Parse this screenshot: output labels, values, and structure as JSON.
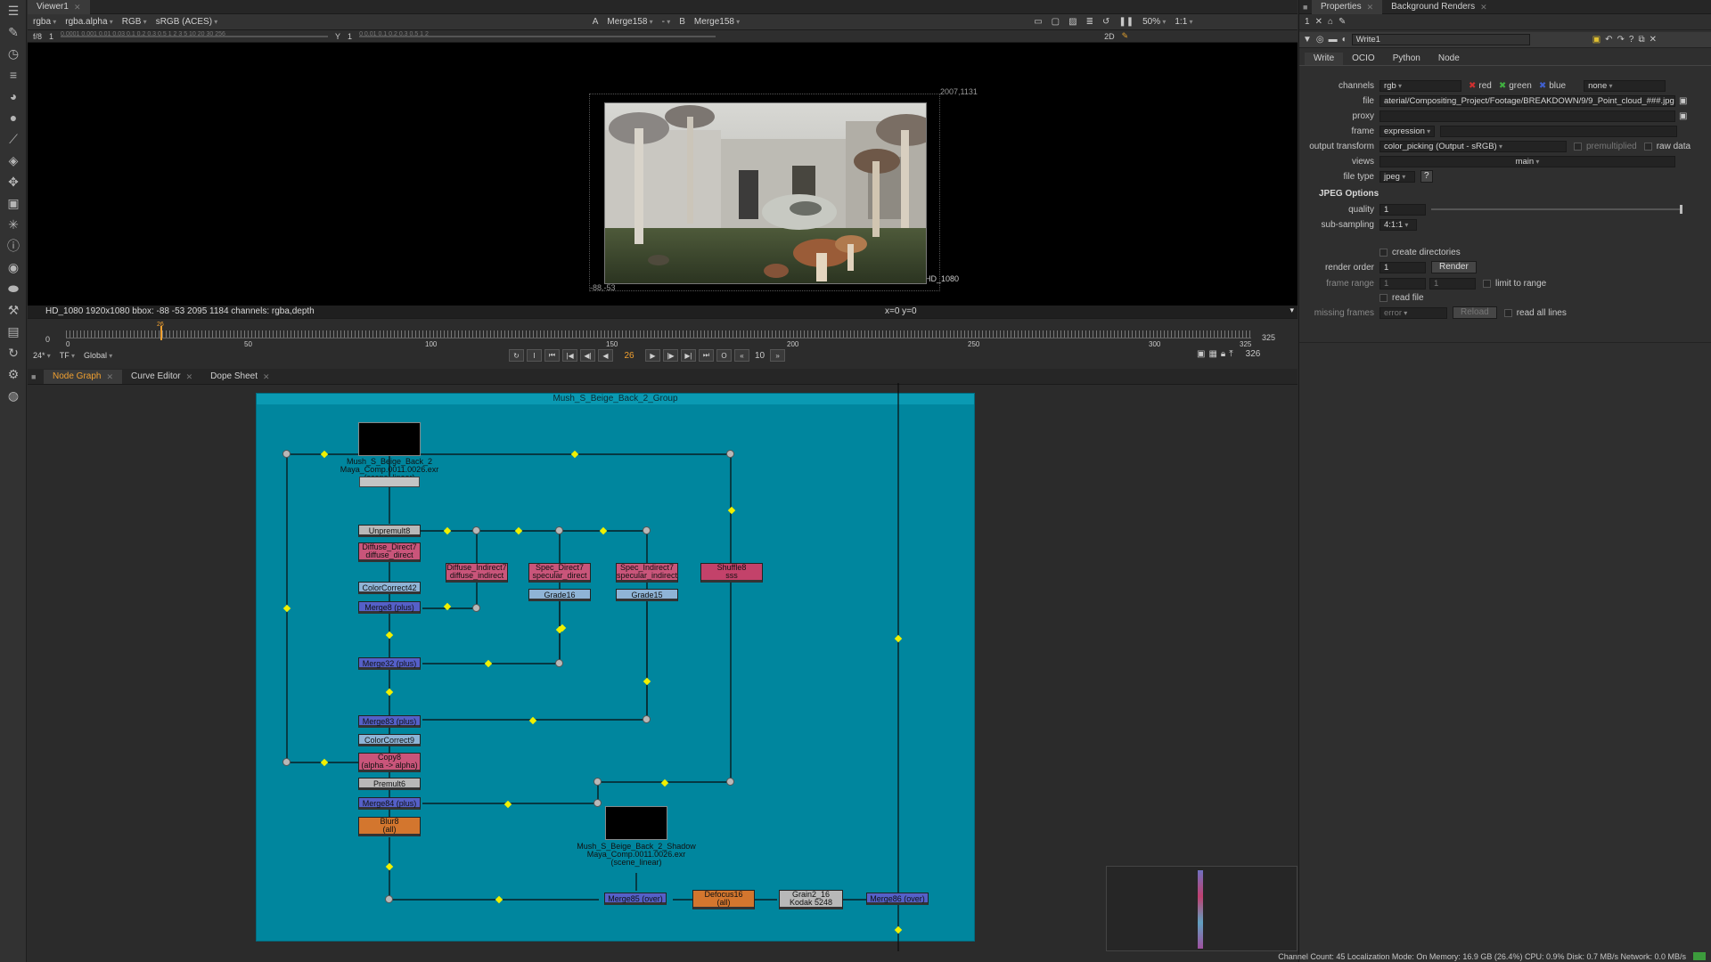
{
  "toolbar": {
    "icons": [
      "menu-icon",
      "pen-icon",
      "clock-icon",
      "layers-icon",
      "palette-icon",
      "circle-icon",
      "brush-icon",
      "stack-icon",
      "transform-icon",
      "cube-icon",
      "particles-icon",
      "info-icon",
      "eye-icon",
      "paint-icon",
      "tools-icon",
      "disk-icon",
      "refresh-icon",
      "gear-icon",
      "globe-icon"
    ]
  },
  "viewer": {
    "tab_label": "Viewer1",
    "channels": "rgba",
    "alpha_channel": "rgba.alpha",
    "display": "RGB",
    "colorspace": "sRGB (ACES)",
    "input_a_label": "A",
    "input_a": "Merge158",
    "input_a_op": "-",
    "input_b_label": "B",
    "input_b": "Merge158",
    "zoom": "50%",
    "ratio": "1:1",
    "view_mode": "2D",
    "fstop": "f/8",
    "gain": "1",
    "gamma_label": "Y",
    "gamma": "1",
    "gain_ticks": [
      "0.0001",
      "0.001",
      "0.01",
      "0.03",
      "0.1",
      "0.2",
      "0.3",
      "0.5",
      "1",
      "2",
      "3",
      "5",
      "10",
      "20",
      "30",
      "256"
    ],
    "gamma_ticks": [
      "0",
      "0.01",
      "0.1",
      "0.2",
      "0.3",
      "0.5",
      "1",
      "2"
    ],
    "bbox_top_right": "2007,1131",
    "bbox_bottom_left": "-88,-53",
    "format_label": "HD_1080",
    "info_left": "HD_1080 1920x1080  bbox: -88 -53 2095 1184 channels: rgba,depth",
    "info_center": "x=0 y=0"
  },
  "timeline": {
    "start": "0",
    "end": "325",
    "current_frame": "26",
    "ticks": [
      "0",
      "50",
      "100",
      "150",
      "200",
      "250",
      "300",
      "325"
    ],
    "out_frame": "325",
    "fps": "24*",
    "tf": "TF",
    "scope": "Global",
    "step": "10",
    "last_frame": "326",
    "marker": "26"
  },
  "graph": {
    "tabs": [
      {
        "label": "Node Graph"
      },
      {
        "label": "Curve Editor"
      },
      {
        "label": "Dope Sheet"
      }
    ],
    "group_title": "Mush_S_Beige_Back_2_Group",
    "nodes": {
      "read1": "Mush_S_Beige_Back_2\nMaya_Comp.0011.0026.exr\n(scene_linear)",
      "unpremult": "Unpremult8",
      "diffuse_direct": "Diffuse_Direct7\ndiffuse_direct",
      "diffuse_indirect": "Diffuse_Indirect7\ndiffuse_indirect",
      "spec_direct": "Spec_Direct7\nspecular_direct",
      "spec_indirect": "Spec_Indirect7\nspecular_indirect",
      "shuffle": "Shuffle8\nsss",
      "cc42": "ColorCorrect42",
      "grade16": "Grade16",
      "grade15": "Grade15",
      "merge8": "Merge8 (plus)",
      "merge32": "Merge32 (plus)",
      "merge83": "Merge83 (plus)",
      "cc9": "ColorCorrect9",
      "copy8": "Copy8\n(alpha -> alpha)",
      "premult": "Premult6",
      "merge84": "Merge84 (plus)",
      "blur": "Blur8\n(all)",
      "read2": "Mush_S_Beige_Back_2_Shadow\nMaya_Comp.0011.0026.exr\n(scene_linear)",
      "merge85": "Merge85 (over)",
      "defocus": "Defocus16\n(all)",
      "grain": "Grain2_16\nKodak 5248",
      "merge86": "Merge86 (over)"
    }
  },
  "properties": {
    "tabs": [
      {
        "label": "Properties"
      },
      {
        "label": "Background Renders"
      }
    ],
    "node_name": "Write1",
    "panel_count": "1",
    "subtabs": [
      "Write",
      "OCIO",
      "Python",
      "Node"
    ],
    "channels_label": "channels",
    "channels": "rgb",
    "red": "red",
    "green": "green",
    "blue": "blue",
    "extra": "none",
    "file_label": "file",
    "file": "aterial/Compositing_Project/Footage/BREAKDOWN/9/9_Point_cloud_###.jpg",
    "proxy_label": "proxy",
    "frame_label": "frame",
    "frame": "expression",
    "output_transform_label": "output transform",
    "output_transform": "color_picking (Output - sRGB)",
    "premultiplied": "premultiplied",
    "raw_data": "raw data",
    "views_label": "views",
    "views": "main",
    "file_type_label": "file type",
    "file_type": "jpeg",
    "help": "?",
    "jpeg_options": "JPEG Options",
    "quality_label": "quality",
    "quality": "1",
    "quality_ticks": [
      "0",
      "0.1",
      "0.2",
      "0.3",
      "0.4",
      "0.5",
      "0.6",
      "0.7",
      "0.8",
      "0.9",
      "1"
    ],
    "subsampling_label": "sub-sampling",
    "subsampling": "4:1:1",
    "create_directories": "create directories",
    "render_order_label": "render order",
    "render_order": "1",
    "render_button": "Render",
    "frame_range_label": "frame range",
    "frame_range_start": "1",
    "frame_range_end": "1",
    "limit_to_range": "limit to range",
    "read_file": "read file",
    "missing_frames_label": "missing frames",
    "missing_frames": "error",
    "reload_button": "Reload",
    "read_all_lines": "read all lines"
  },
  "status": "Channel Count: 45  Localization Mode: On  Memory: 16.9 GB (26.4%)  CPU: 0.9%  Disk: 0.7 MB/s  Network: 0.0 MB/s",
  "colors": {
    "group_bg": "#00869e",
    "accent": "#f0a030",
    "pin": "#f0f000"
  }
}
